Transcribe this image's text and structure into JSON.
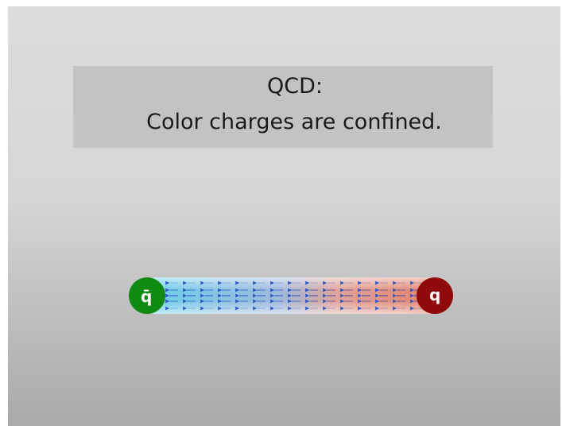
{
  "slide": {
    "title_line1": "QCD:",
    "title_line2": "Color charges are confined."
  },
  "diagram": {
    "antiquark": {
      "label": "q̄",
      "color": "#118a11"
    },
    "quark": {
      "label": "q",
      "color": "#8f0a0a"
    },
    "flux_tube": {
      "left_color": "#4fc8e8",
      "right_color": "#e8806a"
    }
  },
  "colors": {
    "title_box": "#c3c3c3",
    "text": "#1a1a1a"
  }
}
